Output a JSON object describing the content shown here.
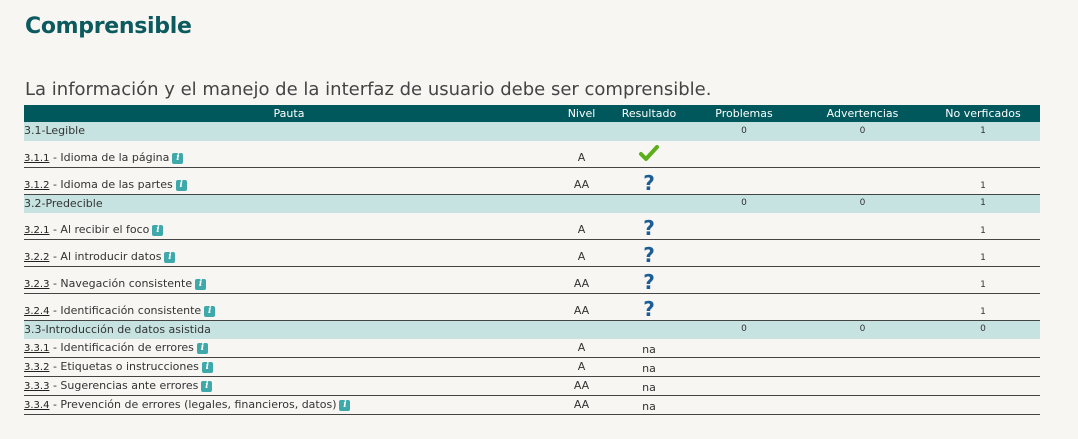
{
  "title": "Comprensible",
  "subtitle": "La información y el manejo de la interfaz de usuario debe ser comprensible.",
  "headers": {
    "pauta": "Pauta",
    "nivel": "Nivel",
    "resultado": "Resultado",
    "problemas": "Problemas",
    "advertencias": "Advertencias",
    "no_verificados": "No verficados"
  },
  "groups": [
    {
      "name": "3.1-Legible",
      "problemas": "0",
      "advertencias": "0",
      "no_verificados": "1",
      "rows": [
        {
          "code": "3.1.1",
          "name": " - Idioma de la página",
          "nivel": "A",
          "result_icon": "check-icon",
          "no_verificados": ""
        },
        {
          "code": "3.1.2",
          "name": " - Idioma de las partes",
          "nivel": "AA",
          "result_icon": "question-icon",
          "no_verificados": "1"
        }
      ]
    },
    {
      "name": "3.2-Predecible",
      "problemas": "0",
      "advertencias": "0",
      "no_verificados": "1",
      "rows": [
        {
          "code": "3.2.1",
          "name": " - Al recibir el foco",
          "nivel": "A",
          "result_icon": "question-icon",
          "no_verificados": "1"
        },
        {
          "code": "3.2.2",
          "name": " - Al introducir datos",
          "nivel": "A",
          "result_icon": "question-icon",
          "no_verificados": "1"
        },
        {
          "code": "3.2.3",
          "name": " - Navegación consistente",
          "nivel": "AA",
          "result_icon": "question-icon",
          "no_verificados": "1"
        },
        {
          "code": "3.2.4",
          "name": " - Identificación consistente",
          "nivel": "AA",
          "result_icon": "question-icon",
          "no_verificados": "1"
        }
      ]
    },
    {
      "name": "3.3-Introducción de datos asistida",
      "problemas": "0",
      "advertencias": "0",
      "no_verificados": "0",
      "rows": [
        {
          "code": "3.3.1",
          "name": " - Identificación de errores",
          "nivel": "A",
          "result": "na"
        },
        {
          "code": "3.3.2",
          "name": " - Etiquetas o instrucciones",
          "nivel": "A",
          "result": "na"
        },
        {
          "code": "3.3.3",
          "name": " - Sugerencias ante errores",
          "nivel": "AA",
          "result": "na"
        },
        {
          "code": "3.3.4",
          "name": " - Prevención de errores (legales, financieros, datos)",
          "nivel": "AA",
          "result": "na"
        }
      ]
    }
  ],
  "info_icon_glyph": "i",
  "colors": {
    "header_bg": "#00585d",
    "group_bg": "#c6e3e1",
    "title": "#0c5a5e",
    "check": "#5cae1a",
    "question": "#1d5d96",
    "info": "#3fa8aa"
  }
}
